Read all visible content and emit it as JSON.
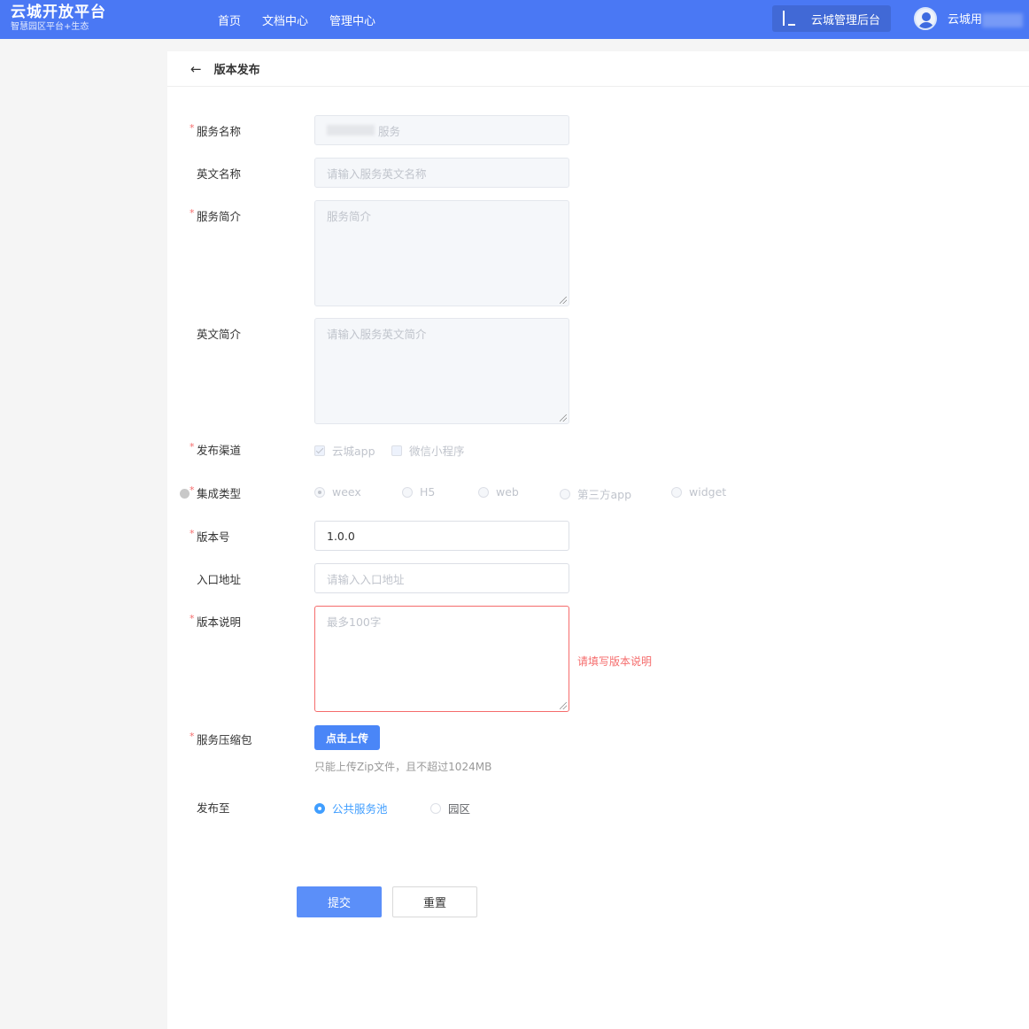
{
  "header": {
    "logo_title": "云城开放平台",
    "logo_subtitle": "智慧园区平台+生态",
    "nav": [
      "首页",
      "文档中心",
      "管理中心"
    ],
    "admin_button": "云城管理后台",
    "user_name": "云城用"
  },
  "page": {
    "title": "版本发布"
  },
  "form": {
    "service_name": {
      "label": "服务名称",
      "required": "*",
      "value": "服务"
    },
    "english_name": {
      "label": "英文名称",
      "placeholder": "请输入服务英文名称"
    },
    "service_intro": {
      "label": "服务简介",
      "required": "*",
      "placeholder": "服务简介"
    },
    "english_intro": {
      "label": "英文简介",
      "placeholder": "请输入服务英文简介"
    },
    "channel": {
      "label": "发布渠道",
      "required": "*",
      "options": [
        "云城app",
        "微信小程序"
      ],
      "checked": "云城app"
    },
    "integration": {
      "label": "集成类型",
      "required": "*",
      "options": [
        "weex",
        "H5",
        "web",
        "第三方app",
        "widget"
      ],
      "selected": "weex"
    },
    "version": {
      "label": "版本号",
      "required": "*",
      "value": "1.0.0"
    },
    "entry": {
      "label": "入口地址",
      "placeholder": "请输入入口地址"
    },
    "version_desc": {
      "label": "版本说明",
      "required": "*",
      "placeholder": "最多100字",
      "error": "请填写版本说明"
    },
    "package": {
      "label": "服务压缩包",
      "required": "*",
      "button": "点击上传",
      "tip": "只能上传Zip文件，且不超过1024MB"
    },
    "publish_to": {
      "label": "发布至",
      "options": [
        "公共服务池",
        "园区"
      ],
      "selected": "公共服务池"
    }
  },
  "actions": {
    "submit": "提交",
    "reset": "重置"
  },
  "colors": {
    "header_bg": "#4a78f4",
    "primary": "#409eff",
    "error": "#f56c6c",
    "submit_bg": "#5b8ff9"
  }
}
